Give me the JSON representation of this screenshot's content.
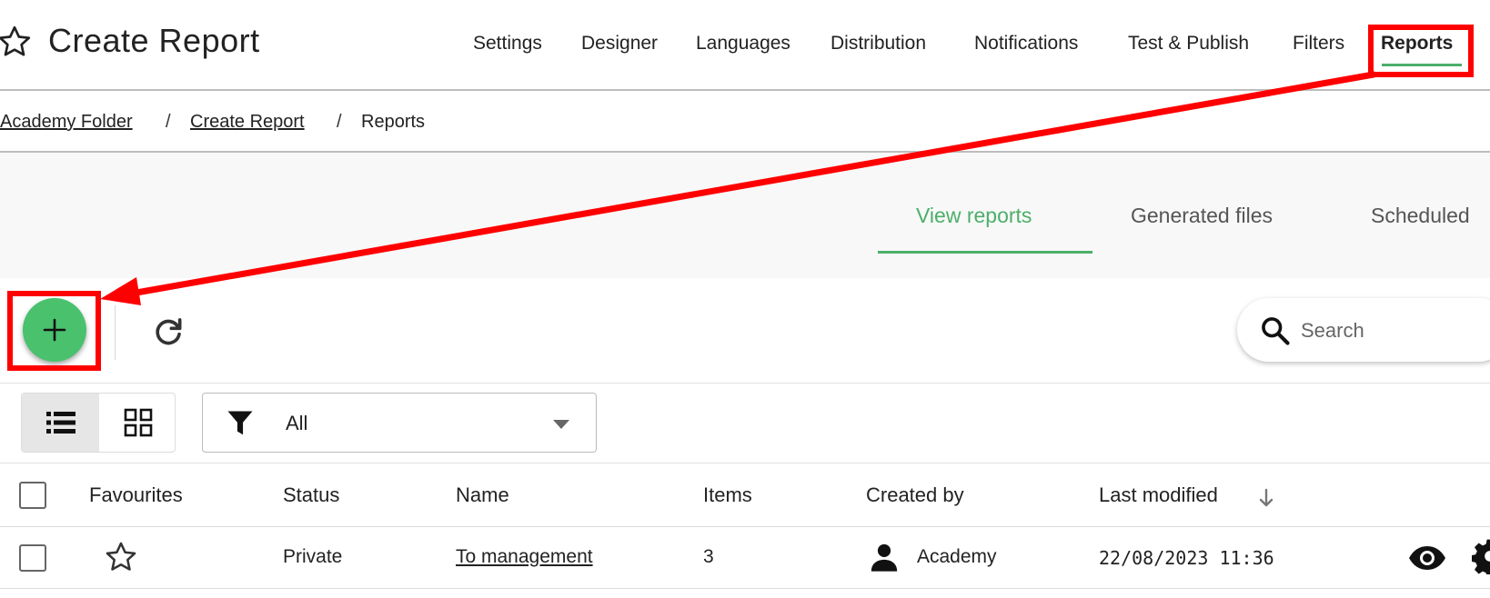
{
  "header": {
    "title": "Create Report",
    "nav": [
      {
        "label": "Settings"
      },
      {
        "label": "Designer"
      },
      {
        "label": "Languages"
      },
      {
        "label": "Distribution"
      },
      {
        "label": "Notifications"
      },
      {
        "label": "Test & Publish"
      },
      {
        "label": "Filters"
      },
      {
        "label": "Reports",
        "active": true
      }
    ]
  },
  "breadcrumb": {
    "items": [
      "Academy Folder",
      "Create Report",
      "Reports"
    ],
    "separator": "/"
  },
  "tabs": [
    {
      "label": "View reports",
      "active": true
    },
    {
      "label": "Generated files"
    },
    {
      "label": "Scheduled"
    }
  ],
  "toolbar": {
    "add_icon": "plus-icon",
    "refresh_icon": "refresh-icon",
    "search": {
      "placeholder": "Search",
      "value": ""
    }
  },
  "filter": {
    "selected": "All"
  },
  "table": {
    "columns": [
      "Favourites",
      "Status",
      "Name",
      "Items",
      "Created by",
      "Last modified"
    ],
    "sort_column": "Last modified",
    "sort_direction": "desc",
    "rows": [
      {
        "favourite": false,
        "status": "Private",
        "name": "To management",
        "items": "3",
        "created_by": "Academy",
        "last_modified": "22/08/2023 11:36"
      }
    ]
  },
  "colors": {
    "accent": "#4caf6a",
    "fab": "#49c16d",
    "annotation": "#ff0000"
  }
}
